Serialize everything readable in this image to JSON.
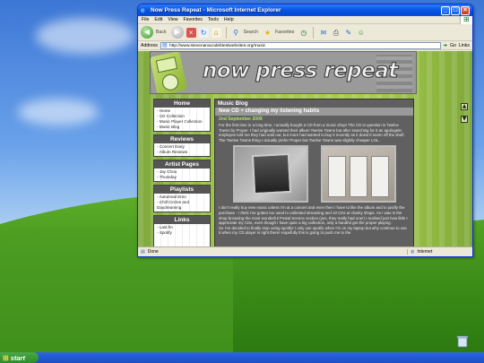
{
  "window": {
    "title": "Now Press Repeat - Microsoft Internet Explorer",
    "controls": {
      "min": "_",
      "max": "□",
      "close": "×"
    }
  },
  "menu": [
    "File",
    "Edit",
    "View",
    "Favorites",
    "Tools",
    "Help"
  ],
  "toolbar": {
    "back_label": "Back",
    "search_label": "Search",
    "favorites_label": "Favorites"
  },
  "address": {
    "label": "Address",
    "url": "http://www.stevenanacodebtestwebsites.org/music",
    "go_label": "Go",
    "links_label": "Links"
  },
  "site": {
    "logo": "now press repeat"
  },
  "sidebar": {
    "home": {
      "title": "Home",
      "items": [
        "Home",
        "CD Collection",
        "Music Player Collection",
        "Music Blog"
      ]
    },
    "reviews": {
      "title": "Reviews",
      "items": [
        "Concert Diary",
        "Album Reviews"
      ]
    },
    "artists": {
      "title": "Artist Pages",
      "items": [
        "Jay Chou",
        "Thursday"
      ]
    },
    "playlists": {
      "title": "Playlists",
      "items": [
        "Autumnal Emo",
        "Chill Circles and Daydreaming"
      ]
    },
    "links": {
      "title": "Links",
      "items": [
        "Last.fm",
        "Spotify"
      ]
    }
  },
  "blog": {
    "heading": "Music Blog",
    "post_title": "New CD + changing my listening habits",
    "post_date": "2nd September 2009",
    "para1": "For the first time in a long time, I actually bought a CD from a music shop! The CD in question is Twelve Towns by Proper. I had originally wanted their album Twelve Towns but after searching for it an apologetic employee told me they had sold out, but more had wanted to buy it recently as it doesn't seem off the shelf. The Twelve Towns thing I actually prefer Proper but Twelve Towns was slightly cheaper LOL.",
    "para2": "I don't really buy new music unless I'm at a concert and even then I have to like the album and to justify the purchase - I think I've gotten too used to unlimited streaming and 10 CDs at charity shops. As I was in the shop browsing the most wonderful Postal Service section (yes, they really had one!) I realised just how little I appreciate my CDs, even though I have quite a big collection, only a handful get the proper playing.",
    "para3": "So I've decided to finally stop using spotify! I only use spotify when I'm on my laptop but why continue to use it when my CD player is right there! Hopefully this is going to push me to the"
  },
  "status": {
    "left": "Done",
    "zone": "Internet"
  },
  "taskbar": {
    "start_label": "start"
  }
}
